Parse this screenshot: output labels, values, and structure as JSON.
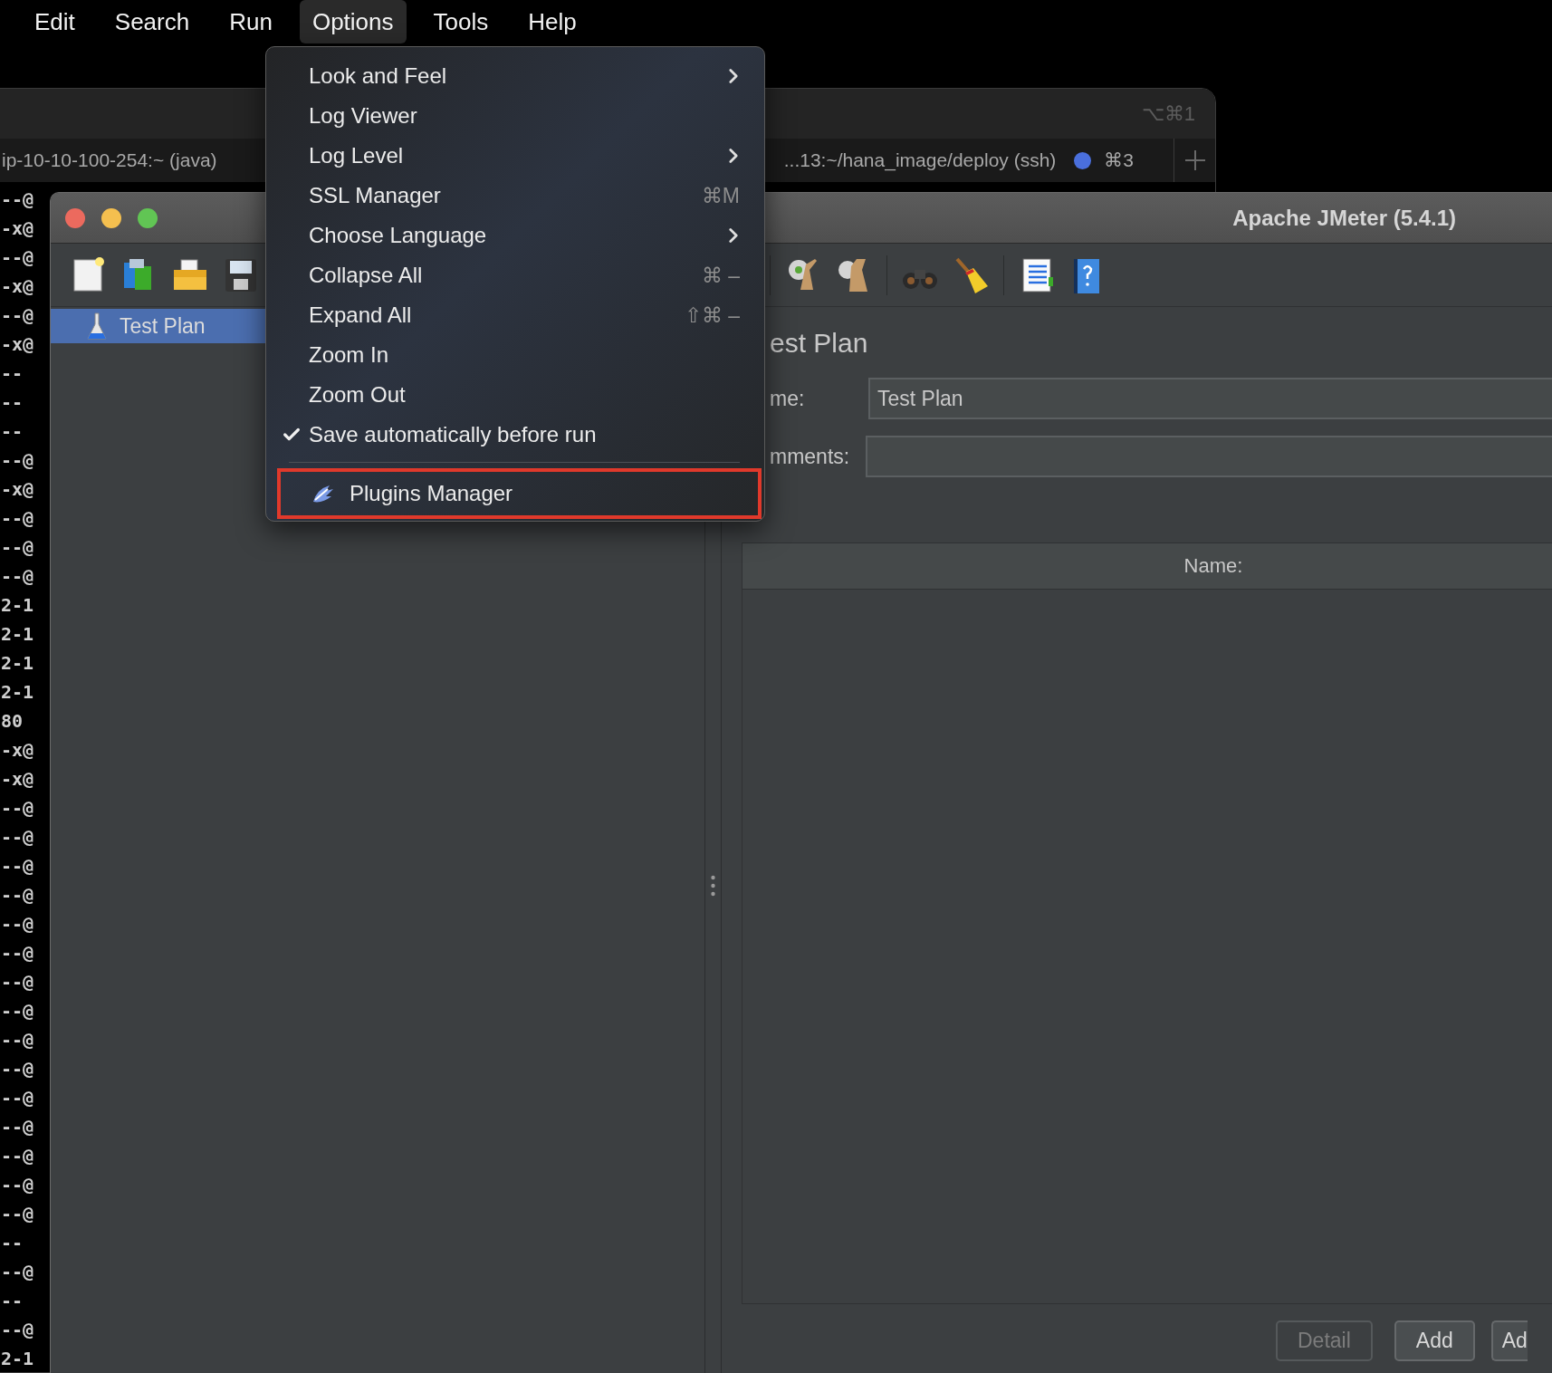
{
  "menu_bar": [
    {
      "label": "Edit",
      "selected": false
    },
    {
      "label": "Search",
      "selected": false
    },
    {
      "label": "Run",
      "selected": false
    },
    {
      "label": "Options",
      "selected": true
    },
    {
      "label": "Tools",
      "selected": false
    },
    {
      "label": "Help",
      "selected": false
    }
  ],
  "options_menu": {
    "groups": [
      [
        {
          "label": "Look and Feel",
          "kind": "submenu",
          "checked": false,
          "highlighted": false
        },
        {
          "label": "Log Viewer",
          "kind": "plain",
          "checked": false,
          "highlighted": false
        },
        {
          "label": "Log Level",
          "kind": "submenu",
          "checked": false,
          "highlighted": false
        },
        {
          "label": "SSL Manager",
          "kind": "shortcut",
          "shortcut": "⌘M",
          "checked": false,
          "highlighted": false
        },
        {
          "label": "Choose Language",
          "kind": "submenu",
          "checked": false,
          "highlighted": false
        },
        {
          "label": "Collapse All",
          "kind": "shortcut",
          "shortcut": "⌘ –",
          "checked": false,
          "highlighted": false
        },
        {
          "label": "Expand All",
          "kind": "shortcut",
          "shortcut": "⇧⌘ –",
          "checked": false,
          "highlighted": false
        },
        {
          "label": "Zoom In",
          "kind": "plain",
          "checked": false,
          "highlighted": false
        },
        {
          "label": "Zoom Out",
          "kind": "plain",
          "checked": false,
          "highlighted": false
        },
        {
          "label": "Save automatically before run",
          "kind": "plain",
          "checked": true,
          "highlighted": false
        }
      ],
      [
        {
          "label": "Plugins Manager",
          "kind": "icon",
          "highlighted": true
        }
      ]
    ]
  },
  "terminal": {
    "window_shortcut": "⌥⌘1",
    "tabs": [
      {
        "label": "ip-10-10-100-254:~ (java)",
        "dot": false
      },
      {
        "label": "...13:~/hana_image/deploy (ssh)",
        "dot": true,
        "shortcut": "⌘3"
      }
    ],
    "lines": [
      "--@",
      "-x@",
      "--@",
      "-x@",
      "--@",
      "-x@",
      "--",
      "--",
      "--",
      "--@",
      "-x@",
      "--@",
      "--@",
      "--@",
      "2-1",
      "2-1",
      "2-1",
      "2-1",
      "80",
      "-x@",
      "-x@",
      "--@",
      "--@",
      "--@",
      "--@",
      "--@",
      "--@",
      "--@",
      "--@",
      "--@",
      "--@",
      "--@",
      "--@",
      "--@",
      "--@",
      "--@",
      "--",
      "--@",
      "--",
      "--@",
      "2-1"
    ]
  },
  "jmeter": {
    "title": "Apache JMeter (5.4.1)",
    "tree": [
      {
        "label": "Test Plan",
        "selected": true
      }
    ],
    "panel": {
      "heading": "est Plan",
      "fields": [
        {
          "label": "me:",
          "value": "Test Plan"
        },
        {
          "label": "mments:"
        }
      ],
      "table": {
        "columns": [
          "Name:"
        ]
      },
      "buttons": [
        {
          "label": "Detail",
          "disabled": true
        },
        {
          "label": "Add",
          "disabled": false
        },
        {
          "label": "Ad",
          "disabled": false
        }
      ]
    }
  }
}
